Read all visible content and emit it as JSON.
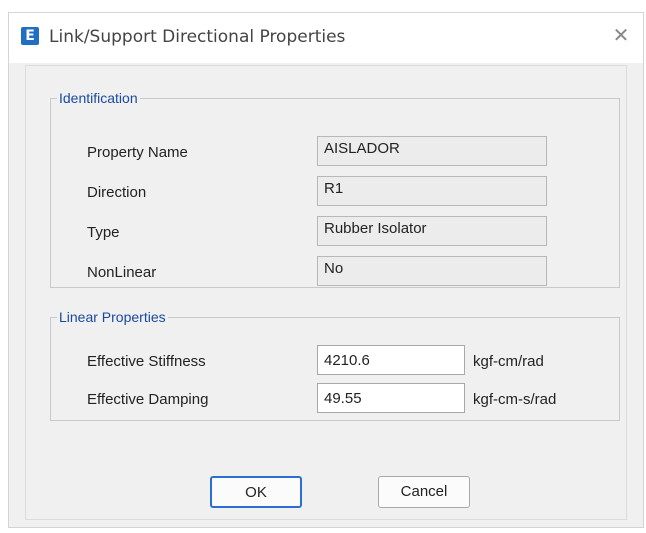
{
  "window": {
    "title": "Link/Support Directional Properties",
    "app_icon_letter": "E",
    "close_glyph": "✕"
  },
  "identification": {
    "legend": "Identification",
    "property_name_label": "Property Name",
    "property_name_value": "AISLADOR",
    "direction_label": "Direction",
    "direction_value": "R1",
    "type_label": "Type",
    "type_value": "Rubber Isolator",
    "nonlinear_label": "NonLinear",
    "nonlinear_value": "No"
  },
  "linear_properties": {
    "legend": "Linear Properties",
    "stiffness_label": "Effective Stiffness",
    "stiffness_value": "4210.6",
    "stiffness_unit": "kgf-cm/rad",
    "damping_label": "Effective Damping",
    "damping_value": "49.55",
    "damping_unit": "kgf-cm-s/rad"
  },
  "buttons": {
    "ok_label": "OK",
    "cancel_label": "Cancel"
  },
  "colors": {
    "accent": "#2a6fcf",
    "legend_text": "#1a4aa0",
    "app_icon": "#1f6fc5"
  }
}
